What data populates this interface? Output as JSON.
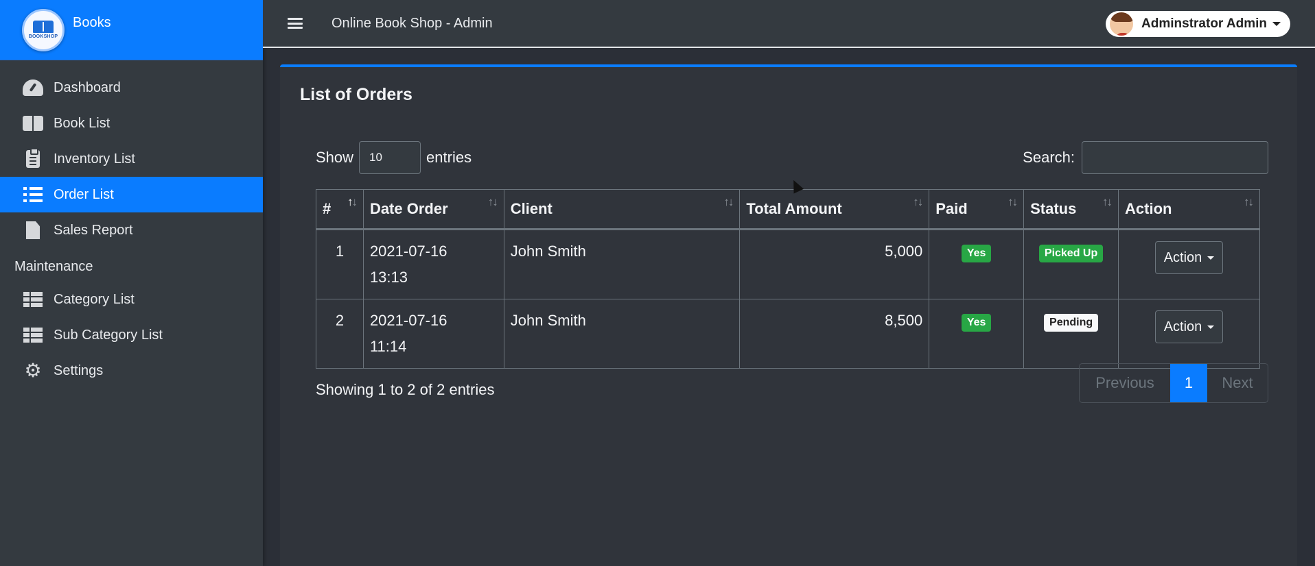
{
  "brand": {
    "name": "Books",
    "logo_text": "BOOKSHOP"
  },
  "sidebar": {
    "items": [
      {
        "label": "Dashboard",
        "icon": "dashboard-icon"
      },
      {
        "label": "Book List",
        "icon": "book-icon"
      },
      {
        "label": "Inventory List",
        "icon": "clipboard-icon"
      },
      {
        "label": "Order List",
        "icon": "list-icon",
        "active": true
      },
      {
        "label": "Sales Report",
        "icon": "file-icon"
      }
    ],
    "section_header": "Maintenance",
    "maintenance_items": [
      {
        "label": "Category List",
        "icon": "table-icon"
      },
      {
        "label": "Sub Category List",
        "icon": "table-icon"
      },
      {
        "label": "Settings",
        "icon": "cogs-icon"
      }
    ]
  },
  "topbar": {
    "title": "Online Book Shop - Admin",
    "user_name": "Adminstrator Admin"
  },
  "card": {
    "title": "List of Orders"
  },
  "table_controls": {
    "show_label": "Show",
    "entries_value": "10",
    "entries_label": "entries",
    "search_label": "Search:",
    "search_value": ""
  },
  "table": {
    "headers": [
      "#",
      "Date Order",
      "Client",
      "Total Amount",
      "Paid",
      "Status",
      "Action"
    ],
    "rows": [
      {
        "num": "1",
        "date": "2021-07-16",
        "time": "13:13",
        "client": "John Smith",
        "amount": "5,000",
        "paid": "Yes",
        "status": "Picked Up",
        "action": "Action"
      },
      {
        "num": "2",
        "date": "2021-07-16",
        "time": "11:14",
        "client": "John Smith",
        "amount": "8,500",
        "paid": "Yes",
        "status": "Pending",
        "action": "Action"
      }
    ]
  },
  "footer": {
    "info": "Showing 1 to 2 of 2 entries",
    "prev": "Previous",
    "page": "1",
    "next": "Next"
  },
  "colors": {
    "accent": "#0a7cff",
    "success": "#28a745",
    "sidebar_bg": "#343a40",
    "content_bg": "#2b2f37"
  }
}
